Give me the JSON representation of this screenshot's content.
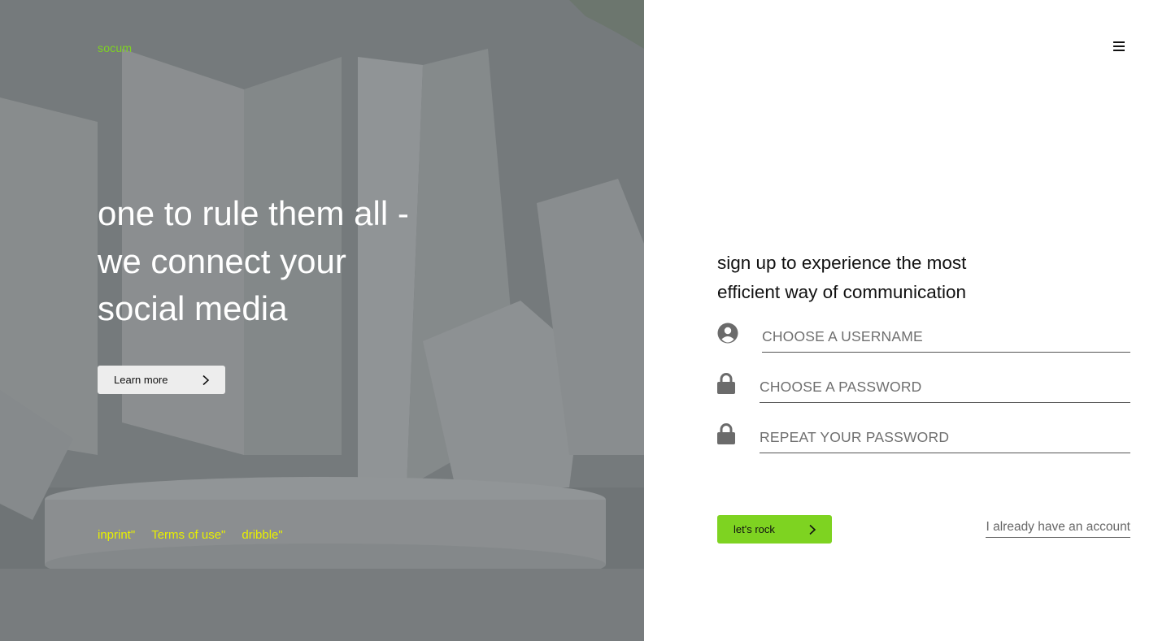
{
  "brand": {
    "name": "socum",
    "accent": "#7ed321",
    "link_color": "#e8f000"
  },
  "hero": {
    "headline_lines": [
      "one to rule them all -",
      "we connect your",
      "social media"
    ],
    "learn_more_label": "Learn more",
    "footer_links": [
      "inprint\"",
      "Terms of use\"",
      "dribble\""
    ]
  },
  "header": {
    "menu_icon": "hamburger-icon"
  },
  "signup": {
    "tagline_lines": [
      "sign up to experience the most",
      "efficient way of communication"
    ],
    "fields": [
      {
        "icon": "user-circle-icon",
        "placeholder": "CHOOSE A USERNAME",
        "value": ""
      },
      {
        "icon": "lock-icon",
        "placeholder": "CHOOSE A PASSWORD",
        "value": ""
      },
      {
        "icon": "lock-icon",
        "placeholder": "REPEAT YOUR PASSWORD",
        "value": ""
      }
    ],
    "submit_label": "let's rock",
    "login_link": "I already have an account"
  }
}
